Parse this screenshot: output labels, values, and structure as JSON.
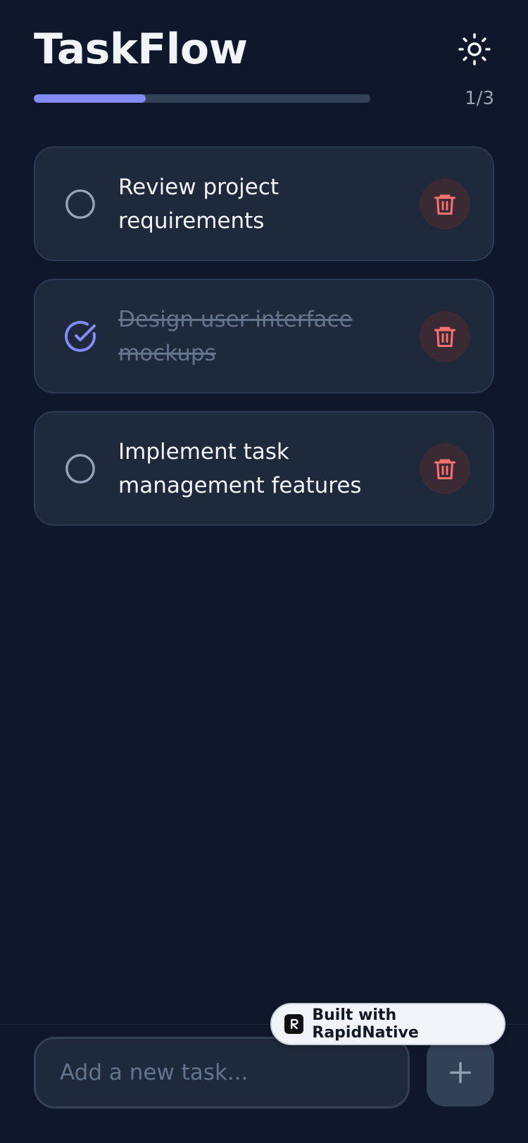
{
  "app": {
    "title": "TaskFlow"
  },
  "progress": {
    "completed": 1,
    "total": 3,
    "label": "1/3"
  },
  "tasks": [
    {
      "text": "Review project requirements",
      "done": false
    },
    {
      "text": "Design user interface mockups",
      "done": true
    },
    {
      "text": "Implement task management features",
      "done": false
    }
  ],
  "input": {
    "placeholder": "Add a new task...",
    "value": ""
  },
  "badge": {
    "text": "Built with RapidNative"
  },
  "icons": {
    "theme": "sun-icon",
    "unchecked": "circle-icon",
    "checked": "check-circle-icon",
    "delete": "trash-icon",
    "add": "plus-icon",
    "badge_logo": "rapidnative-logo-icon"
  },
  "colors": {
    "background": "#0f172a",
    "card": "#1e293b",
    "accent": "#818cf8",
    "delete": "#f87171",
    "muted": "#94a3b8"
  }
}
